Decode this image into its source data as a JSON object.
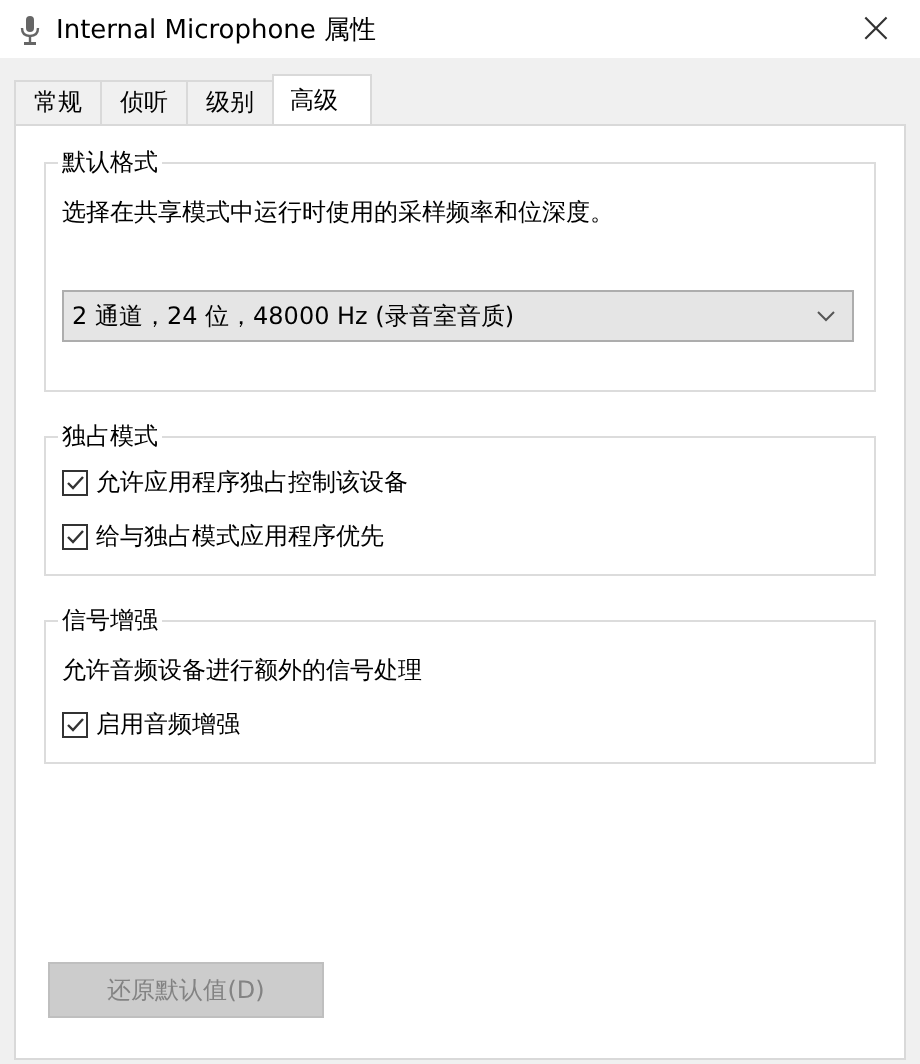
{
  "window": {
    "title": "Internal Microphone 属性",
    "close": "×"
  },
  "tabs": [
    {
      "label": "常规",
      "selected": false
    },
    {
      "label": "侦听",
      "selected": false
    },
    {
      "label": "级别",
      "selected": false
    },
    {
      "label": "高级",
      "selected": true
    }
  ],
  "groups": [
    {
      "title": "默认格式",
      "description": "选择在共享模式中运行时使用的采样频率和位深度。",
      "dropdown": {
        "value": "2 通道，24 位，48000 Hz (录音室音质)"
      }
    },
    {
      "title": "独占模式",
      "checkboxes": [
        {
          "label": "允许应用程序独占控制该设备",
          "checked": true
        },
        {
          "label": "给与独占模式应用程序优先",
          "checked": true
        }
      ]
    },
    {
      "title": "信号增强",
      "description": "允许音频设备进行额外的信号处理",
      "checkboxes": [
        {
          "label": "启用音频增强",
          "checked": true
        }
      ]
    }
  ],
  "restore_button": {
    "label": "还原默认值(D)",
    "disabled": true
  }
}
